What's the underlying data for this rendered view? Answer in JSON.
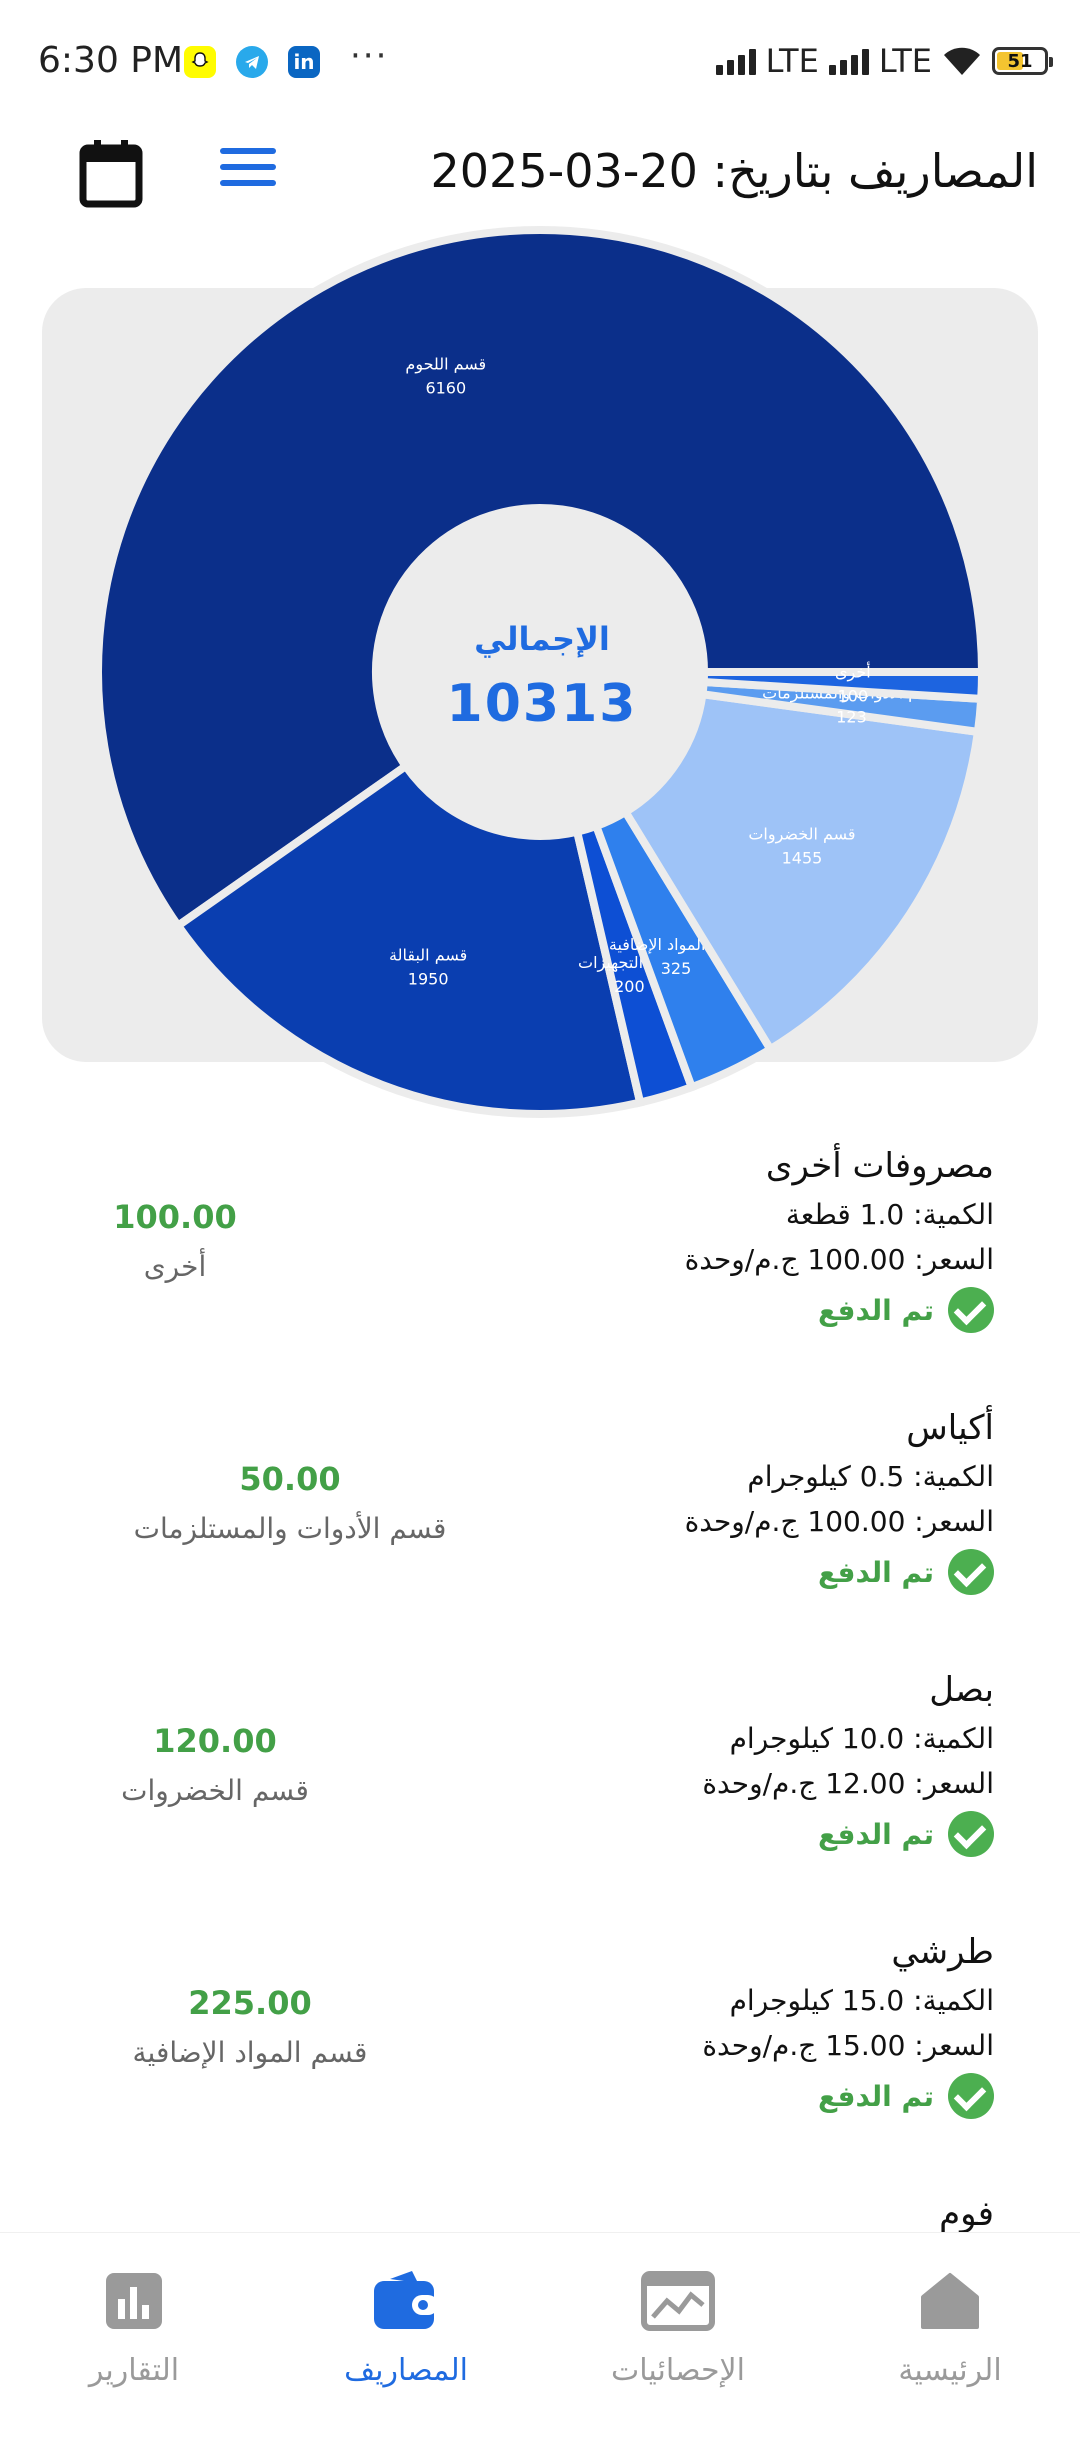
{
  "status_bar": {
    "time": "6:30 PM",
    "network1": "LTE",
    "network2": "LTE",
    "battery": "51",
    "dots": "···",
    "app_icons": [
      "snapchat-icon",
      "telegram-icon",
      "linkedin-icon"
    ]
  },
  "header": {
    "title": "المصاريف بتاريخ: 20-03-2025",
    "menu_icon": "hamburger-menu-icon",
    "calendar_icon": "calendar-icon"
  },
  "chart_data": {
    "type": "pie",
    "donut": true,
    "center_title": "الإجمالي",
    "center_value": "10313",
    "slices": [
      {
        "label": "قسم اللحوم",
        "value": 6160,
        "color": "#0b2f8a"
      },
      {
        "label": "قسم البقالة",
        "value": 1950,
        "color": "#0a3eb0"
      },
      {
        "label": "قسم التجهيزات",
        "value": 200,
        "color": "#0d4fd4"
      },
      {
        "label": "قسم المواد الإضافية",
        "value": 325,
        "color": "#2f80ed"
      },
      {
        "label": "قسم الخضروات",
        "value": 1455,
        "color": "#9ec3f7"
      },
      {
        "label": "قسم الأدوات والمستلزمات",
        "value": 123,
        "color": "#5b9cf0"
      },
      {
        "label": "أخرى",
        "value": 100,
        "color": "#1d64e0"
      }
    ],
    "slice_labels": [
      {
        "name": "قسم اللحوم",
        "value": "6160"
      },
      {
        "name": "قسم البقالة",
        "value": "1950"
      },
      {
        "name": "قسم التجهيزات",
        "value": "200"
      },
      {
        "name": "قسم المواد الإضافية",
        "value": "325"
      },
      {
        "name": "قسم الخضروات",
        "value": "1455"
      },
      {
        "name": "قسم الأدوات والمستلزمات",
        "value": "123"
      },
      {
        "name": "أخرى",
        "value": "100"
      }
    ]
  },
  "expenses": [
    {
      "name": "مصروفات أخرى",
      "quantity": "الكمية: 1.0 قطعة",
      "price": "السعر: 100.00 ج.م/وحدة",
      "status": "تم الدفع",
      "amount": "100.00",
      "category": "أخرى"
    },
    {
      "name": "أكياس",
      "quantity": "الكمية: 0.5 كيلوجرام",
      "price": "السعر: 100.00 ج.م/وحدة",
      "status": "تم الدفع",
      "amount": "50.00",
      "category": "قسم الأدوات والمستلزمات"
    },
    {
      "name": "بصل",
      "quantity": "الكمية: 10.0 كيلوجرام",
      "price": "السعر: 12.00 ج.م/وحدة",
      "status": "تم الدفع",
      "amount": "120.00",
      "category": "قسم الخضروات"
    },
    {
      "name": "طرشي",
      "quantity": "الكمية: 15.0 كيلوجرام",
      "price": "السعر: 15.00 ج.م/وحدة",
      "status": "تم الدفع",
      "amount": "225.00",
      "category": "قسم المواد الإضافية"
    },
    {
      "name": "فوم"
    }
  ],
  "nav": {
    "items": [
      {
        "label": "التقارير",
        "icon": "reports-chart-icon",
        "active": false
      },
      {
        "label": "المصاريف",
        "icon": "wallet-icon",
        "active": true
      },
      {
        "label": "الإحصائيات",
        "icon": "statistics-icon",
        "active": false
      },
      {
        "label": "الرئيسية",
        "icon": "home-icon",
        "active": false
      }
    ],
    "active_color": "#1f6be0",
    "inactive_color": "#9a9a9a"
  }
}
